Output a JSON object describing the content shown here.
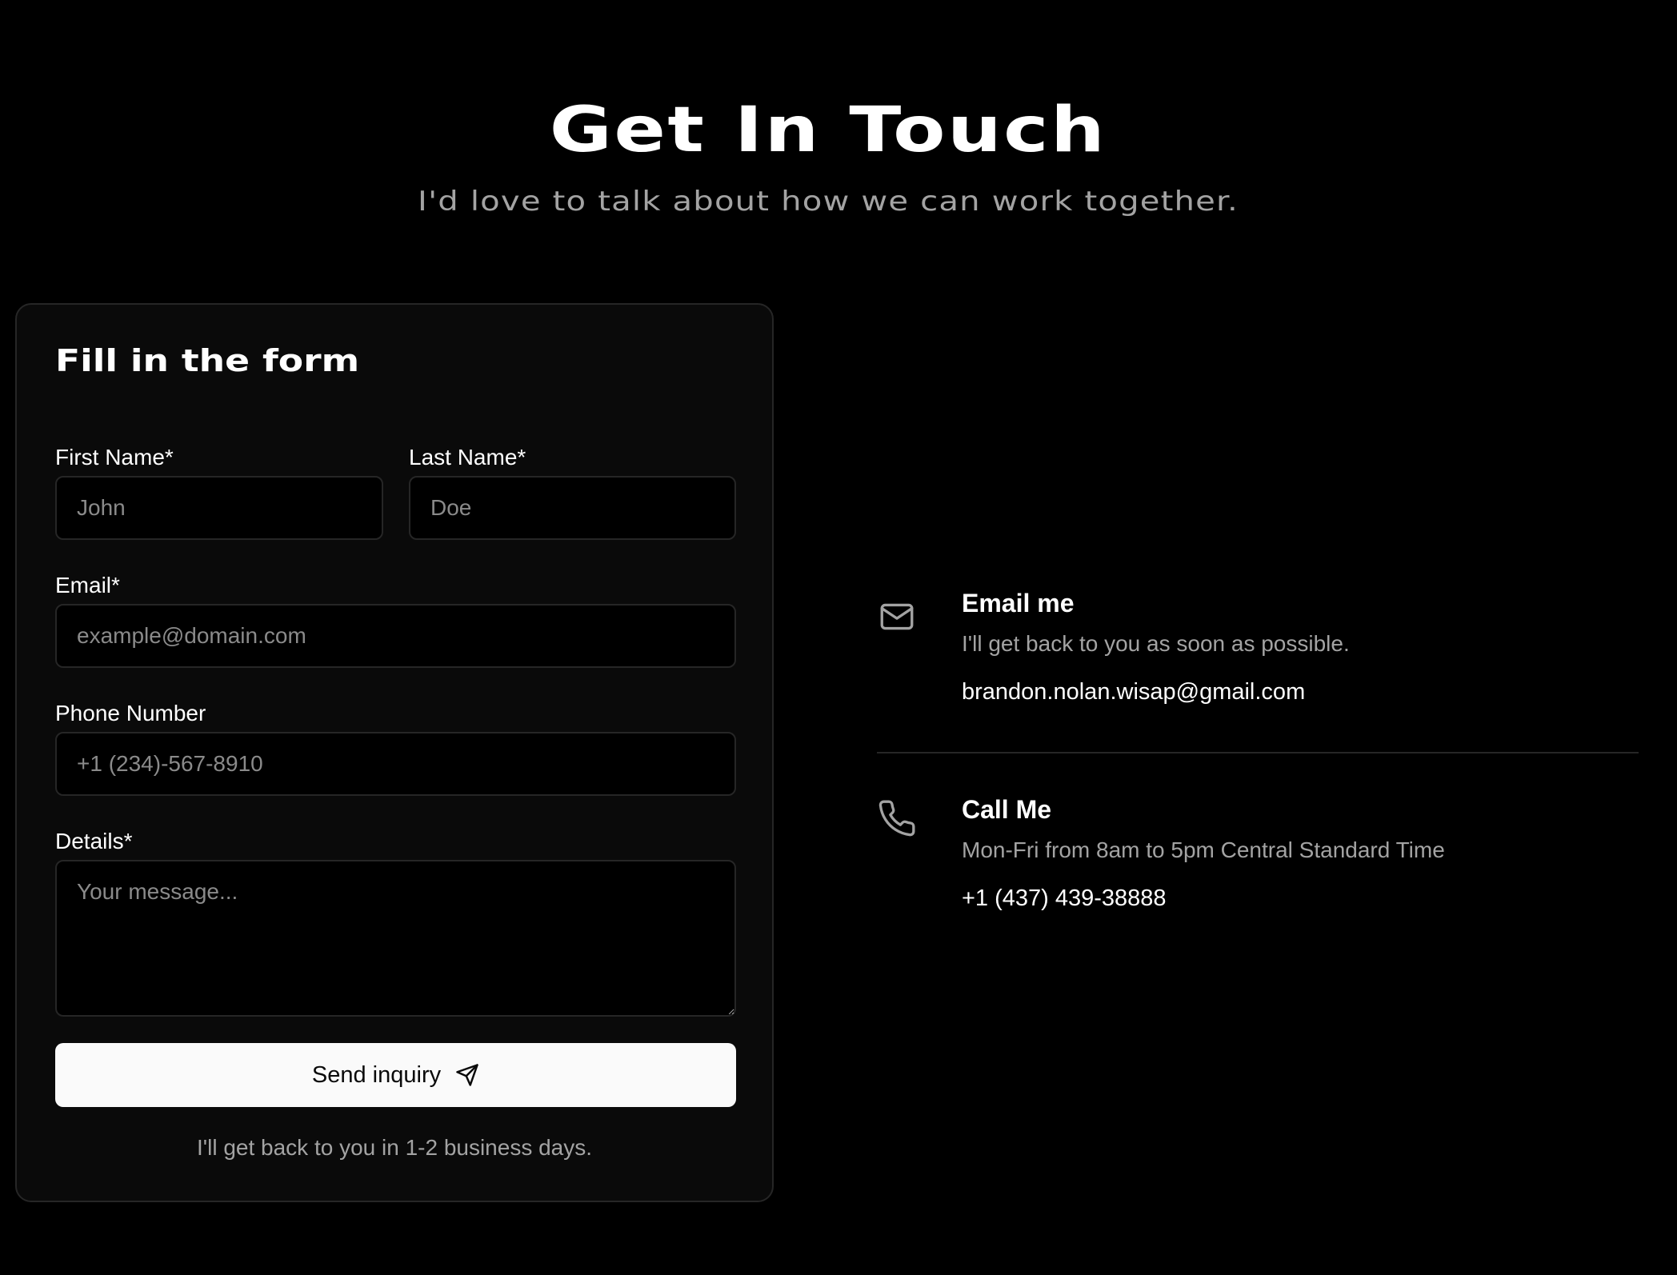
{
  "hero": {
    "title": "Get In Touch",
    "subtitle": "I'd love to talk about how we can work together."
  },
  "form": {
    "title": "Fill in the form",
    "first_name": {
      "label": "First Name*",
      "placeholder": "John"
    },
    "last_name": {
      "label": "Last Name*",
      "placeholder": "Doe"
    },
    "email": {
      "label": "Email*",
      "placeholder": "example@domain.com"
    },
    "phone": {
      "label": "Phone Number",
      "placeholder": "+1 (234)-567-8910"
    },
    "details": {
      "label": "Details*",
      "placeholder": "Your message..."
    },
    "submit_label": "Send inquiry",
    "submit_icon": "send-icon",
    "note": "I'll get back to you in 1-2 business days."
  },
  "contact": {
    "email": {
      "icon": "mail-icon",
      "title": "Email me",
      "subtitle": "I'll get back to you as soon as possible.",
      "value": "brandon.nolan.wisap@gmail.com"
    },
    "phone": {
      "icon": "phone-icon",
      "title": "Call Me",
      "subtitle": "Mon-Fri from 8am to 5pm Central Standard Time",
      "value": "+1 (437) 439-38888"
    }
  },
  "colors": {
    "background": "#000000",
    "card": "#0a0a0a",
    "border": "#262626",
    "muted_text": "#a3a3a3",
    "button_bg": "#fafafa",
    "button_text": "#0a0a0a"
  }
}
